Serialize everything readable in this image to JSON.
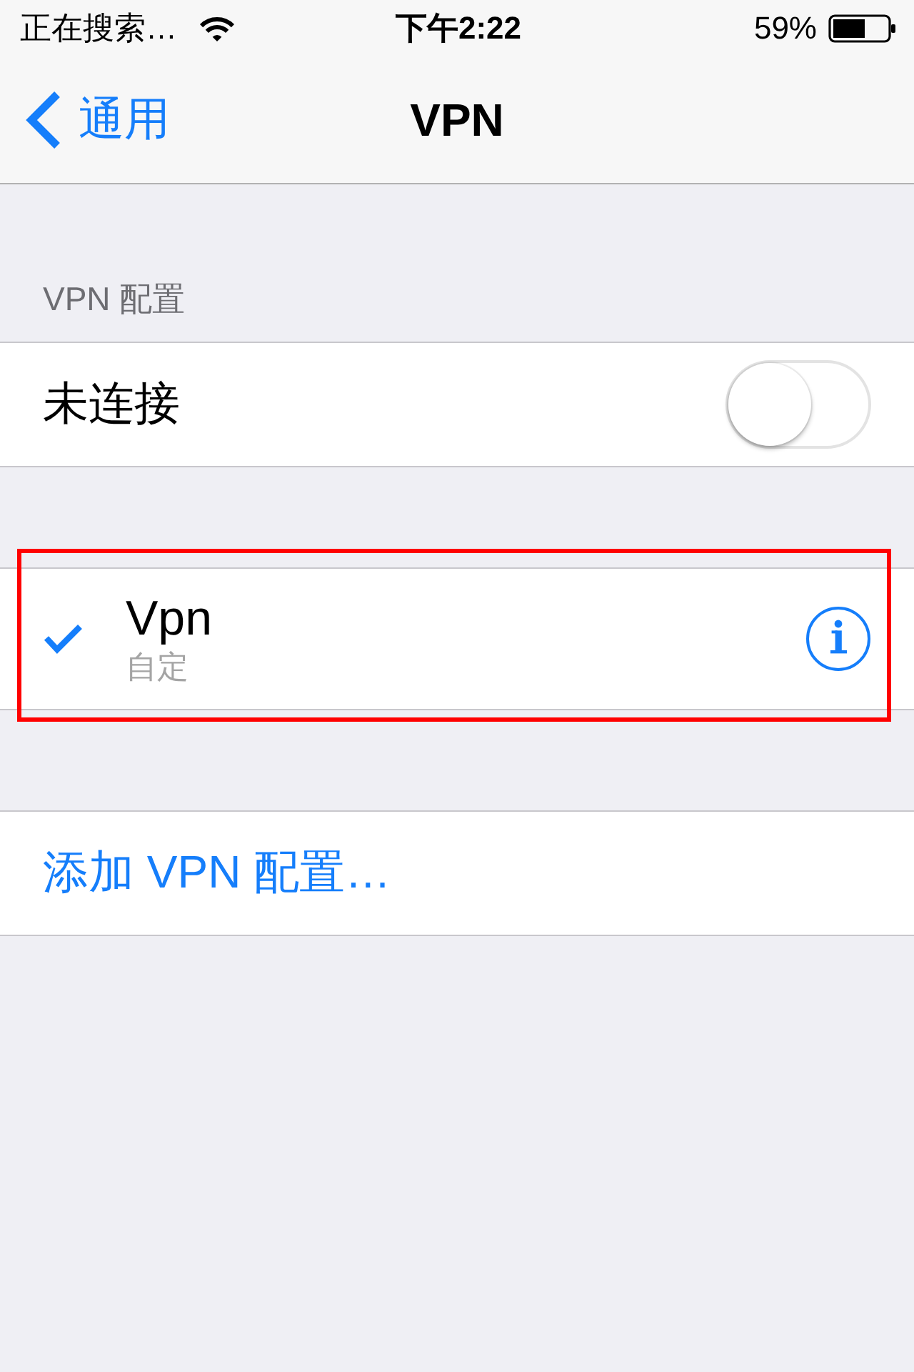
{
  "status_bar": {
    "carrier": "正在搜索…",
    "time": "下午2:22",
    "battery": "59%"
  },
  "nav_bar": {
    "back": "通用",
    "title": "VPN"
  },
  "status_section": {
    "header": "VPN 配置",
    "status": "未连接",
    "on": false
  },
  "configurations": [
    {
      "name": "Vpn",
      "type": "自定",
      "selected": true,
      "highlighted": true
    }
  ],
  "add_configuration": "添加 VPN 配置…"
}
